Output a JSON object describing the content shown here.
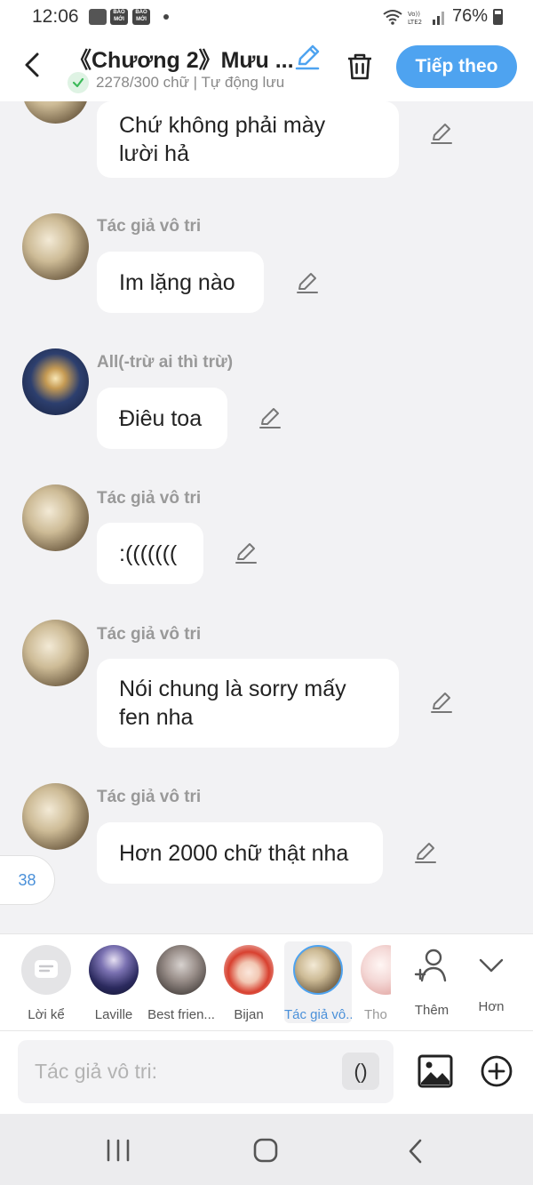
{
  "status_bar": {
    "time": "12:06",
    "notif_badge": "BÁO MỚI",
    "battery": "76%"
  },
  "header": {
    "title": "《Chương 2》Mưu ...",
    "subtitle": "2278/300 chữ | Tự động lưu",
    "next_label": "Tiếp theo"
  },
  "messages": [
    {
      "text_line1": "Chứ không phải mày",
      "text_line2": "lười hả"
    },
    {
      "sender": "Tác giả vô tri",
      "text": "Im lặng nào"
    },
    {
      "sender": "All(-trừ ai thì trừ)",
      "text": "Điêu toa"
    },
    {
      "sender": "Tác giả vô tri",
      "text": ":((((((("
    },
    {
      "sender": "Tác giả vô tri",
      "text_line1": "Nói chung là sorry mấy",
      "text_line2": "fen nha"
    },
    {
      "sender": "Tác giả vô tri",
      "text": "Hơn 2000 chữ thật nha"
    }
  ],
  "counter_badge": "38",
  "characters": [
    {
      "name": "Lời kể"
    },
    {
      "name": "Laville"
    },
    {
      "name": "Best frien..."
    },
    {
      "name": "Bijan"
    },
    {
      "name": "Tác giả vô..."
    },
    {
      "name": "Tho"
    }
  ],
  "actions": {
    "add_label": "Thêm",
    "more_label": "Hơn"
  },
  "input": {
    "placeholder": "Tác giả vô tri:",
    "paren_label": "()"
  },
  "colors": {
    "accent": "#4ea3f0",
    "background": "#f2f2f4",
    "bubble": "#ffffff"
  }
}
